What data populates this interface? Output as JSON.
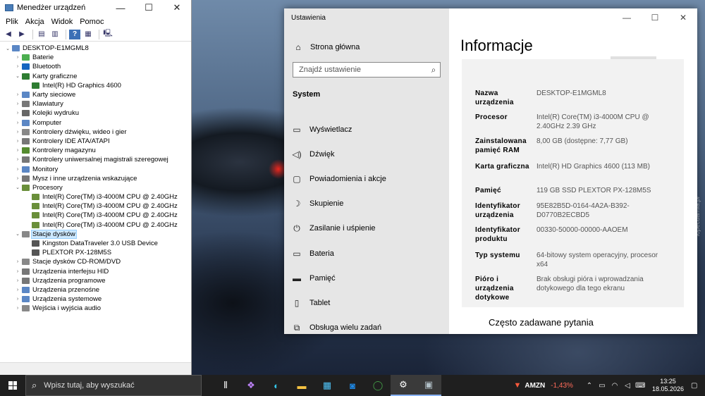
{
  "device_manager": {
    "title": "Menedżer urządzeń",
    "menu": [
      "Plik",
      "Akcja",
      "Widok",
      "Pomoc"
    ],
    "tree": [
      {
        "label": "DESKTOP-E1MGML8",
        "level": 0,
        "expanded": true,
        "icon": "computer-icon",
        "color": "#5b87c5"
      },
      {
        "label": "Baterie",
        "level": 1,
        "expanded": false,
        "icon": "battery-icon",
        "color": "#4caf50"
      },
      {
        "label": "Bluetooth",
        "level": 1,
        "expanded": false,
        "icon": "bluetooth-icon",
        "color": "#1565c0"
      },
      {
        "label": "Karty graficzne",
        "level": 1,
        "expanded": true,
        "icon": "display-adapter-icon",
        "color": "#2e7d32"
      },
      {
        "label": "Intel(R) HD Graphics 4600",
        "level": 2,
        "icon": "display-adapter-icon",
        "color": "#2e7d32"
      },
      {
        "label": "Karty sieciowe",
        "level": 1,
        "expanded": false,
        "icon": "network-icon",
        "color": "#5b87c5"
      },
      {
        "label": "Klawiatury",
        "level": 1,
        "expanded": false,
        "icon": "keyboard-icon",
        "color": "#777777"
      },
      {
        "label": "Kolejki wydruku",
        "level": 1,
        "expanded": false,
        "icon": "printer-icon",
        "color": "#666666"
      },
      {
        "label": "Komputer",
        "level": 1,
        "expanded": false,
        "icon": "computer-icon",
        "color": "#5b87c5"
      },
      {
        "label": "Kontrolery dźwięku, wideo i gier",
        "level": 1,
        "expanded": false,
        "icon": "speaker-icon",
        "color": "#888888"
      },
      {
        "label": "Kontrolery IDE ATA/ATAPI",
        "level": 1,
        "expanded": false,
        "icon": "controller-icon",
        "color": "#777777"
      },
      {
        "label": "Kontrolery magazynu",
        "level": 1,
        "expanded": false,
        "icon": "storage-controller-icon",
        "color": "#558b2f"
      },
      {
        "label": "Kontrolery uniwersalnej magistrali szeregowej",
        "level": 1,
        "expanded": false,
        "icon": "usb-icon",
        "color": "#777777"
      },
      {
        "label": "Monitory",
        "level": 1,
        "expanded": false,
        "icon": "monitor-icon",
        "color": "#5b87c5"
      },
      {
        "label": "Mysz i inne urządzenia wskazujące",
        "level": 1,
        "expanded": false,
        "icon": "mouse-icon",
        "color": "#777777"
      },
      {
        "label": "Procesory",
        "level": 1,
        "expanded": true,
        "icon": "processor-icon",
        "color": "#6a8f3a"
      },
      {
        "label": "Intel(R) Core(TM) i3-4000M CPU @ 2.40GHz",
        "level": 2,
        "icon": "processor-icon",
        "color": "#6a8f3a"
      },
      {
        "label": "Intel(R) Core(TM) i3-4000M CPU @ 2.40GHz",
        "level": 2,
        "icon": "processor-icon",
        "color": "#6a8f3a"
      },
      {
        "label": "Intel(R) Core(TM) i3-4000M CPU @ 2.40GHz",
        "level": 2,
        "icon": "processor-icon",
        "color": "#6a8f3a"
      },
      {
        "label": "Intel(R) Core(TM) i3-4000M CPU @ 2.40GHz",
        "level": 2,
        "icon": "processor-icon",
        "color": "#6a8f3a"
      },
      {
        "label": "Stacje dysków",
        "level": 1,
        "expanded": true,
        "selected": true,
        "icon": "disk-drive-icon",
        "color": "#888888"
      },
      {
        "label": "Kingston DataTraveler 3.0 USB Device",
        "level": 2,
        "icon": "disk-drive-icon",
        "color": "#555555"
      },
      {
        "label": "PLEXTOR PX-128M5S",
        "level": 2,
        "icon": "disk-drive-icon",
        "color": "#555555"
      },
      {
        "label": "Stacje dysków CD-ROM/DVD",
        "level": 1,
        "expanded": false,
        "icon": "cdrom-icon",
        "color": "#888888"
      },
      {
        "label": "Urządzenia interfejsu HID",
        "level": 1,
        "expanded": false,
        "icon": "hid-icon",
        "color": "#777777"
      },
      {
        "label": "Urządzenia programowe",
        "level": 1,
        "expanded": false,
        "icon": "software-device-icon",
        "color": "#777777"
      },
      {
        "label": "Urządzenia przenośne",
        "level": 1,
        "expanded": false,
        "icon": "portable-device-icon",
        "color": "#5b87c5"
      },
      {
        "label": "Urządzenia systemowe",
        "level": 1,
        "expanded": false,
        "icon": "system-device-icon",
        "color": "#5b87c5"
      },
      {
        "label": "Wejścia i wyjścia audio",
        "level": 1,
        "expanded": false,
        "icon": "audio-io-icon",
        "color": "#888888"
      }
    ]
  },
  "settings": {
    "app_title": "Ustawienia",
    "home": "Strona główna",
    "search_placeholder": "Znajdź ustawienie",
    "section": "System",
    "nav": [
      {
        "label": "Wyświetlacz",
        "icon": "display-icon",
        "glyph": "▭"
      },
      {
        "label": "Dźwięk",
        "icon": "sound-icon",
        "glyph": "◁)"
      },
      {
        "label": "Powiadomienia i akcje",
        "icon": "notifications-icon",
        "glyph": "▢"
      },
      {
        "label": "Skupienie",
        "icon": "focus-moon-icon",
        "glyph": "☽"
      },
      {
        "label": "Zasilanie i uśpienie",
        "icon": "power-icon",
        "glyph": "⏻"
      },
      {
        "label": "Bateria",
        "icon": "battery-icon",
        "glyph": "▭"
      },
      {
        "label": "Pamięć",
        "icon": "storage-icon",
        "glyph": "▬"
      },
      {
        "label": "Tablet",
        "icon": "tablet-icon",
        "glyph": "▯"
      },
      {
        "label": "Obsługa wielu zadań",
        "icon": "multitasking-icon",
        "glyph": "⧉"
      }
    ],
    "page_title": "Informacje",
    "info": [
      {
        "key": "Nazwa urządzenia",
        "value": "DESKTOP-E1MGML8"
      },
      {
        "key": "Procesor",
        "value": "Intel(R) Core(TM) i3-4000M CPU @ 2.40GHz 2.39 GHz"
      },
      {
        "key": "Zainstalowana pamięć RAM",
        "value": "8,00 GB (dostępne: 7,77 GB)"
      },
      {
        "key": "Karta graficzna",
        "value": "Intel(R) HD Graphics 4600 (113 MB)"
      },
      {
        "key": "Pamięć",
        "value": "119 GB SSD PLEXTOR PX-128M5S"
      },
      {
        "key": "Identyfikator urządzenia",
        "value": "95E82B5D-0164-4A2A-B392-D0770B2ECBD5"
      },
      {
        "key": "Identyfikator produktu",
        "value": "00330-50000-00000-AAOEM"
      },
      {
        "key": "Typ systemu",
        "value": "64-bitowy system operacyjny, procesor x64"
      },
      {
        "key": "Pióro i urządzenia dotykowe",
        "value": "Brak obsługi pióra i wprowadzania dotykowego dla tego ekranu"
      }
    ],
    "faq": "Często zadawane pytania"
  },
  "taskbar": {
    "search_placeholder": "Wpisz tutaj, aby wyszukać",
    "apps": [
      {
        "name": "task-view-icon",
        "glyph": "⫴",
        "color": "#ffffff"
      },
      {
        "name": "copilot-icon",
        "glyph": "❖",
        "color": "#c084fc"
      },
      {
        "name": "edge-icon",
        "glyph": "◐",
        "color": "#34c6e8"
      },
      {
        "name": "file-explorer-icon",
        "glyph": "▬",
        "color": "#f5c242"
      },
      {
        "name": "store-icon",
        "glyph": "▦",
        "color": "#4fc3f7"
      },
      {
        "name": "outlook-icon",
        "glyph": "◙",
        "color": "#1e88e5"
      },
      {
        "name": "app-ring-icon",
        "glyph": "◯",
        "color": "#43a047"
      },
      {
        "name": "settings-gear-icon",
        "glyph": "⚙",
        "color": "#ffffff"
      },
      {
        "name": "device-manager-icon",
        "glyph": "▣",
        "color": "#b0bec5"
      }
    ],
    "stock_symbol": "AMZN",
    "stock_change": "-1,43%",
    "time": "13:25",
    "date": "18.05.2026"
  },
  "watermark": "lopecdarnia.pl"
}
